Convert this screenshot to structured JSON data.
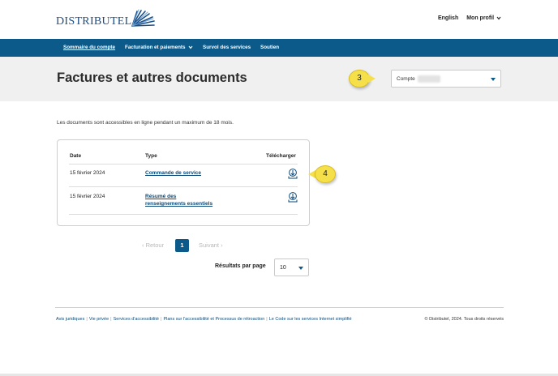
{
  "header": {
    "logo_text": "DISTRIBUTEL",
    "language_link": "English",
    "profile_link": "Mon profil"
  },
  "nav": {
    "items": [
      {
        "label": "Sommaire du compte"
      },
      {
        "label": "Facturation et paiements"
      },
      {
        "label": "Survol des services"
      },
      {
        "label": "Soutien"
      }
    ]
  },
  "hero": {
    "title": "Factures et autres documents",
    "account_label": "Compte"
  },
  "callouts": {
    "account": "3",
    "download": "4"
  },
  "main": {
    "info_text": "Les documents sont accessibles en ligne pendant un maximum de 18 mois.",
    "table": {
      "headers": {
        "date": "Date",
        "type": "Type",
        "download": "Télécharger"
      },
      "rows": [
        {
          "date": "15 février 2024",
          "type_line1": "Commande de service",
          "type_line2": ""
        },
        {
          "date": "15 février 2024",
          "type_line1": "Résumé des",
          "type_line2": "renseignements essentiels"
        }
      ]
    }
  },
  "pagination": {
    "prev": "‹ Retour",
    "current": "1",
    "next": "Suivant ›",
    "per_page_label": "Résultats par page",
    "per_page_value": "10"
  },
  "footer": {
    "links": [
      "Avis juridiques",
      "Vie privée",
      "Services d'accessibilité",
      "Plans sur l'accessibilité et Processus de rétroaction",
      "Le Code sur les services Internet simplifié"
    ],
    "copyright": "© Distributel, 2024. Tous droits réservés"
  },
  "colors": {
    "brand_blue": "#0b5a8a",
    "link_blue": "#0b4a78",
    "callout_yellow": "#f6e04a",
    "hero_bg": "#f0f0f0"
  }
}
